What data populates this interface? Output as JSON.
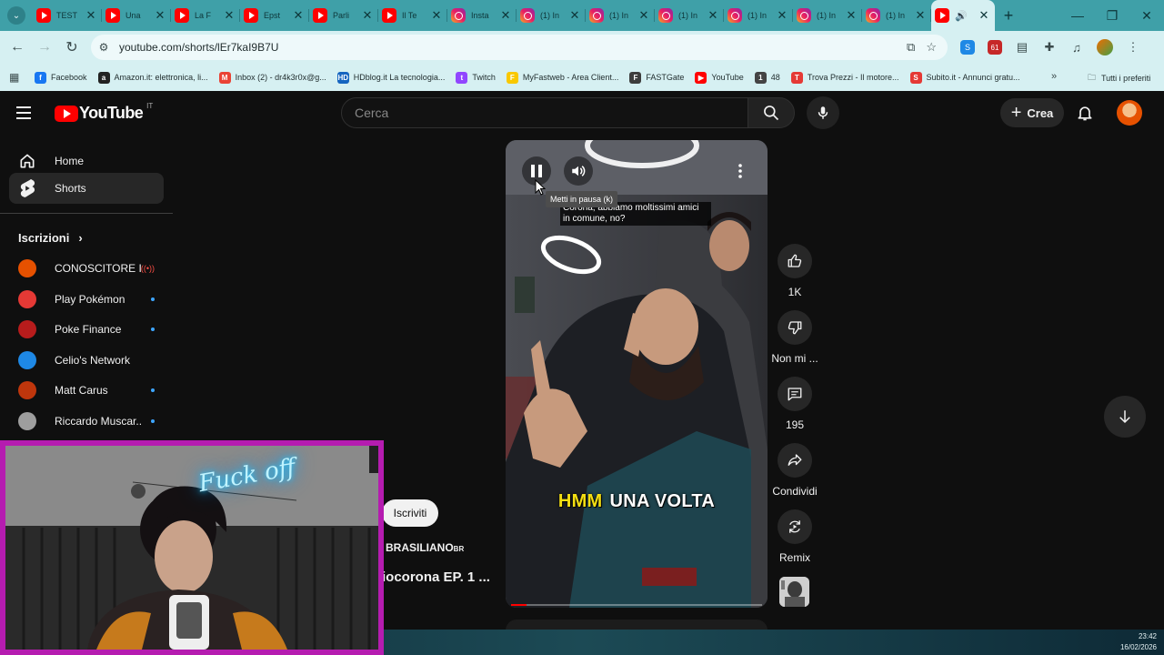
{
  "browser": {
    "tabs": [
      {
        "favicon": "youtube",
        "title": "TEST"
      },
      {
        "favicon": "youtube",
        "title": "Una"
      },
      {
        "favicon": "youtube",
        "title": "La F"
      },
      {
        "favicon": "youtube",
        "title": "Epst"
      },
      {
        "favicon": "youtube",
        "title": "Parli"
      },
      {
        "favicon": "youtube",
        "title": "Il Te"
      },
      {
        "favicon": "instagram",
        "title": "Insta"
      },
      {
        "favicon": "instagram",
        "title": "(1) In"
      },
      {
        "favicon": "instagram",
        "title": "(1) In"
      },
      {
        "favicon": "instagram",
        "title": "(1) In"
      },
      {
        "favicon": "instagram",
        "title": "(1) In"
      },
      {
        "favicon": "instagram",
        "title": "(1) In"
      },
      {
        "favicon": "instagram",
        "title": "(1) In"
      }
    ],
    "active_tab": {
      "favicon": "youtube",
      "audio_icon": "speaker-icon"
    },
    "url": "youtube.com/shorts/lEr7kaI9B7U",
    "bookmarks": [
      {
        "label": "Facebook",
        "icon_color": "#1877f2",
        "glyph": "f"
      },
      {
        "label": "Amazon.it: elettronica, li...",
        "icon_color": "#222222",
        "glyph": "a"
      },
      {
        "label": "Inbox (2) - dr4k3r0x@g...",
        "icon_color": "#ea4335",
        "glyph": "M"
      },
      {
        "label": "HDblog.it La tecnologia...",
        "icon_color": "#1565c0",
        "glyph": "HD"
      },
      {
        "label": "Twitch",
        "icon_color": "#9146ff",
        "glyph": "t"
      },
      {
        "label": "MyFastweb - Area Client...",
        "icon_color": "#f9c800",
        "glyph": "F"
      },
      {
        "label": "FASTGate",
        "icon_color": "#3d3d3d",
        "glyph": "F"
      },
      {
        "label": "YouTube",
        "icon_color": "#ff0000",
        "glyph": "▶"
      },
      {
        "label": "48",
        "icon_color": "#444444",
        "glyph": "1"
      },
      {
        "label": "Trova Prezzi - Il motore...",
        "icon_color": "#e53935",
        "glyph": "T"
      },
      {
        "label": "Subito.it - Annunci gratu...",
        "icon_color": "#e53935",
        "glyph": "S"
      }
    ],
    "all_bookmarks_label": "Tutti i preferiti"
  },
  "youtube": {
    "logo_text": "YouTube",
    "country_code": "IT",
    "search_placeholder": "Cerca",
    "create_label": "Crea",
    "nav": [
      {
        "label": "Home",
        "icon": "home-icon"
      },
      {
        "label": "Shorts",
        "icon": "shorts-icon"
      }
    ],
    "subscriptions_heading": "Iscrizioni",
    "subscriptions": [
      {
        "name": "CONOSCITORE I...",
        "indicator": "live",
        "avatar_color": "#e65100"
      },
      {
        "name": "Play Pokémon",
        "indicator": "new",
        "avatar_color": "#e53935"
      },
      {
        "name": "Poke Finance",
        "indicator": "new",
        "avatar_color": "#b71c1c"
      },
      {
        "name": "Celio's Network",
        "indicator": "none",
        "avatar_color": "#1e88e5"
      },
      {
        "name": "Matt Carus",
        "indicator": "new",
        "avatar_color": "#bf360c"
      },
      {
        "name": "Riccardo Muscar...",
        "indicator": "new",
        "avatar_color": "#9e9e9e"
      }
    ]
  },
  "short": {
    "tooltip": "Metti in pausa (k)",
    "caption": "Corona, abbiamo moltissimi amici in comune, no?",
    "overlay_highlight": "HMM",
    "overlay_text": "UNA VOLTA",
    "progress_fraction": 0.06,
    "subscribe_label": "Iscriviti",
    "channel_name": "BRASILIANO",
    "channel_suffix": "BR",
    "title": "iocorona EP. 1 ...",
    "actions": [
      {
        "icon": "like-icon",
        "label": "1K"
      },
      {
        "icon": "dislike-icon",
        "label": "Non mi ..."
      },
      {
        "icon": "comment-icon",
        "label": "195"
      },
      {
        "icon": "share-icon",
        "label": "Condividi"
      },
      {
        "icon": "remix-icon",
        "label": "Remix"
      }
    ]
  },
  "taskbar": {
    "time": "23:42",
    "date": "16/02/2026"
  },
  "webcam": {
    "neon_sign": "Fuck off"
  },
  "colors": {
    "tab_strip": "#3fa0a8",
    "toolbar": "#d6f0f2",
    "youtube_bg": "#0f0f0f",
    "webcam_border": "#b51cb0",
    "caption_yellow": "#f3de12"
  }
}
